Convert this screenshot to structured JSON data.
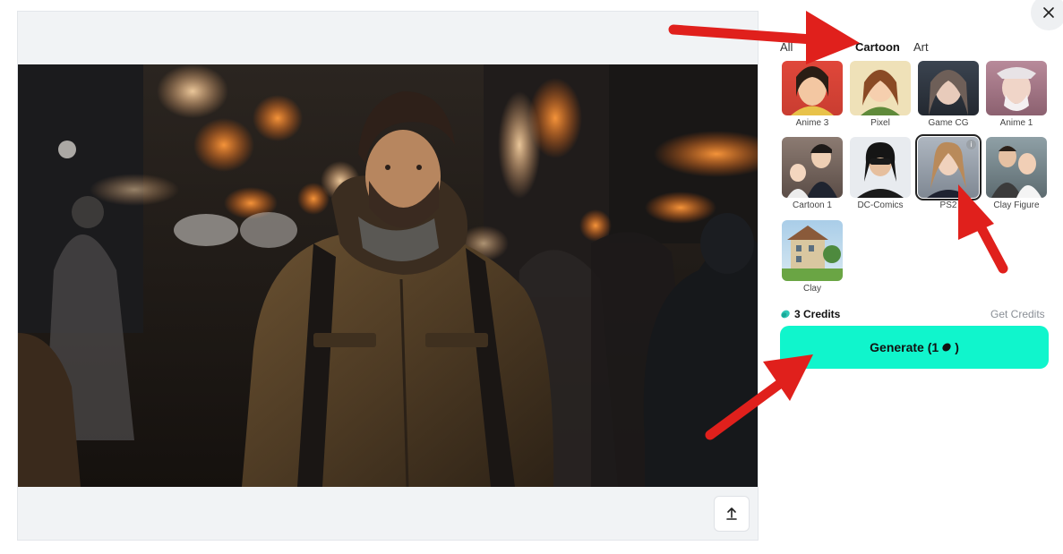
{
  "close": {
    "icon": "close-icon"
  },
  "tabs": [
    {
      "label": "All",
      "active": false
    },
    {
      "label": "Cartoon",
      "active": true
    },
    {
      "label": "Art",
      "active": false
    }
  ],
  "styles": [
    {
      "label": "Anime 3",
      "selected": false
    },
    {
      "label": "Pixel",
      "selected": false
    },
    {
      "label": "Game CG",
      "selected": false
    },
    {
      "label": "Anime 1",
      "selected": false
    },
    {
      "label": "Cartoon 1",
      "selected": false
    },
    {
      "label": "DC-Comics",
      "selected": false
    },
    {
      "label": "PS2",
      "selected": true,
      "info_icon": "i"
    },
    {
      "label": "Clay Figure",
      "selected": false
    },
    {
      "label": "Clay",
      "selected": false
    }
  ],
  "credits": {
    "amount_label": "3 Credits",
    "get_label": "Get Credits"
  },
  "generate": {
    "label_prefix": "Generate (1",
    "label_suffix": ")"
  },
  "preview": {
    "upload_icon": "upload-icon"
  },
  "colors": {
    "accent": "#10f5cc",
    "annotation_arrow": "#e0201c"
  }
}
